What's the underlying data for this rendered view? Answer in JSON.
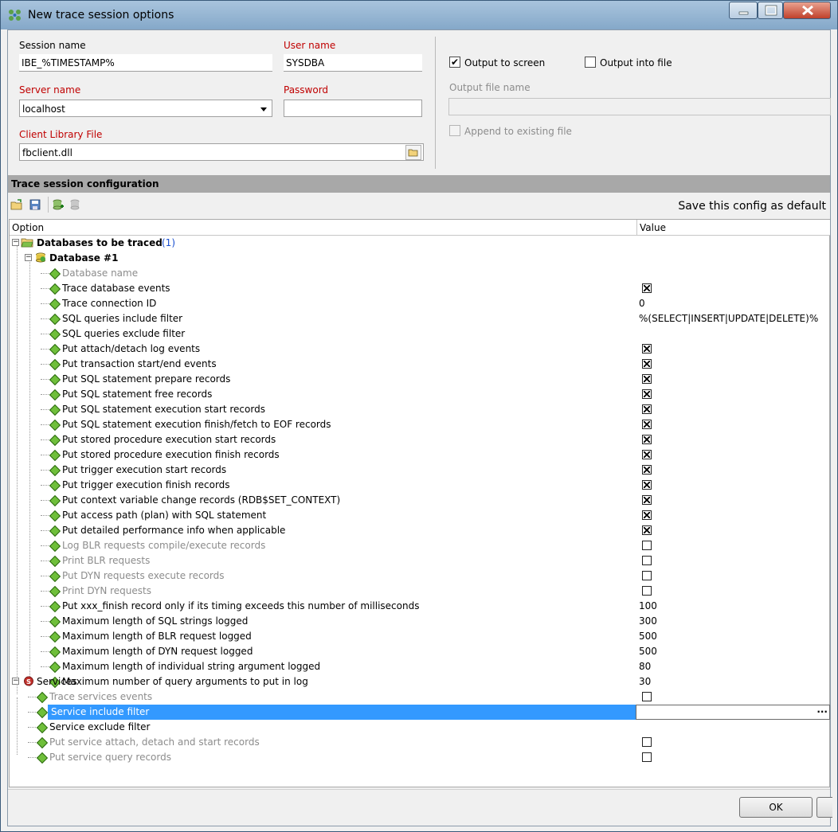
{
  "window": {
    "title": "New trace session options"
  },
  "connection": {
    "session_name_label": "Session name",
    "session_name_value": "IBE_%TIMESTAMP%",
    "user_name_label": "User name",
    "user_name_value": "SYSDBA",
    "server_name_label": "Server name",
    "server_name_value": "localhost",
    "password_label": "Password",
    "password_value": "",
    "client_library_label": "Client Library File",
    "client_library_value": "fbclient.dll"
  },
  "output": {
    "output_to_screen_label": "Output to screen",
    "output_to_screen_checked": true,
    "output_into_file_label": "Output into file",
    "output_into_file_checked": false,
    "output_file_name_label": "Output file name",
    "output_file_name_value": "",
    "append_label": "Append to existing file",
    "append_checked": false
  },
  "config": {
    "section_title": "Trace session configuration",
    "save_default_label": "Save this config as default",
    "col_option": "Option",
    "col_value": "Value",
    "databases_label": "Databases to be traced",
    "databases_count": "(1)",
    "database1_label": "Database #1",
    "services_label": "Services"
  },
  "db_rows": [
    {
      "label": "Database name",
      "type": "text",
      "value": "",
      "dim": true
    },
    {
      "label": "Trace database events",
      "type": "check",
      "checked": true
    },
    {
      "label": "Trace connection ID",
      "type": "text",
      "value": "0"
    },
    {
      "label": "SQL queries include filter",
      "type": "text",
      "value": "%(SELECT|INSERT|UPDATE|DELETE)%"
    },
    {
      "label": "SQL queries exclude filter",
      "type": "text",
      "value": ""
    },
    {
      "label": "Put attach/detach log events",
      "type": "check",
      "checked": true
    },
    {
      "label": "Put transaction start/end events",
      "type": "check",
      "checked": true
    },
    {
      "label": "Put SQL statement prepare records",
      "type": "check",
      "checked": true
    },
    {
      "label": "Put SQL statement free records",
      "type": "check",
      "checked": true
    },
    {
      "label": "Put SQL statement execution start records",
      "type": "check",
      "checked": true
    },
    {
      "label": "Put SQL statement execution finish/fetch to EOF records",
      "type": "check",
      "checked": true
    },
    {
      "label": "Put stored procedure execution start records",
      "type": "check",
      "checked": true
    },
    {
      "label": "Put stored procedure execution finish records",
      "type": "check",
      "checked": true
    },
    {
      "label": "Put trigger execution start records",
      "type": "check",
      "checked": true
    },
    {
      "label": "Put trigger execution finish records",
      "type": "check",
      "checked": true
    },
    {
      "label": "Put context variable change records (RDB$SET_CONTEXT)",
      "type": "check",
      "checked": true
    },
    {
      "label": "Put access path (plan) with SQL statement",
      "type": "check",
      "checked": true
    },
    {
      "label": "Put detailed performance info when applicable",
      "type": "check",
      "checked": true
    },
    {
      "label": "Log BLR requests compile/execute records",
      "type": "check",
      "checked": false,
      "dim": true
    },
    {
      "label": "Print BLR requests",
      "type": "check",
      "checked": false,
      "dim": true
    },
    {
      "label": "Put DYN requests execute records",
      "type": "check",
      "checked": false,
      "dim": true
    },
    {
      "label": "Print DYN requests",
      "type": "check",
      "checked": false,
      "dim": true
    },
    {
      "label": "Put xxx_finish record only if its timing exceeds this number of milliseconds",
      "type": "text",
      "value": "100"
    },
    {
      "label": "Maximum length of SQL strings logged",
      "type": "text",
      "value": "300"
    },
    {
      "label": "Maximum length of BLR request logged",
      "type": "text",
      "value": "500"
    },
    {
      "label": "Maximum length of DYN request logged",
      "type": "text",
      "value": "500"
    },
    {
      "label": "Maximum length of individual string argument logged",
      "type": "text",
      "value": "80"
    },
    {
      "label": "Maximum number of query arguments to put in log",
      "type": "text",
      "value": "30"
    }
  ],
  "svc_rows": [
    {
      "label": "Trace services events",
      "type": "check",
      "checked": false,
      "dim": true
    },
    {
      "label": "Service include filter",
      "type": "edit",
      "value": "",
      "selected": true
    },
    {
      "label": "Service exclude filter",
      "type": "text",
      "value": ""
    },
    {
      "label": "Put service attach, detach and start records",
      "type": "check",
      "checked": false,
      "dim": true
    },
    {
      "label": "Put service query records",
      "type": "check",
      "checked": false,
      "dim": true
    }
  ],
  "footer": {
    "ok_label": "OK",
    "edit_ellipsis": "..."
  }
}
